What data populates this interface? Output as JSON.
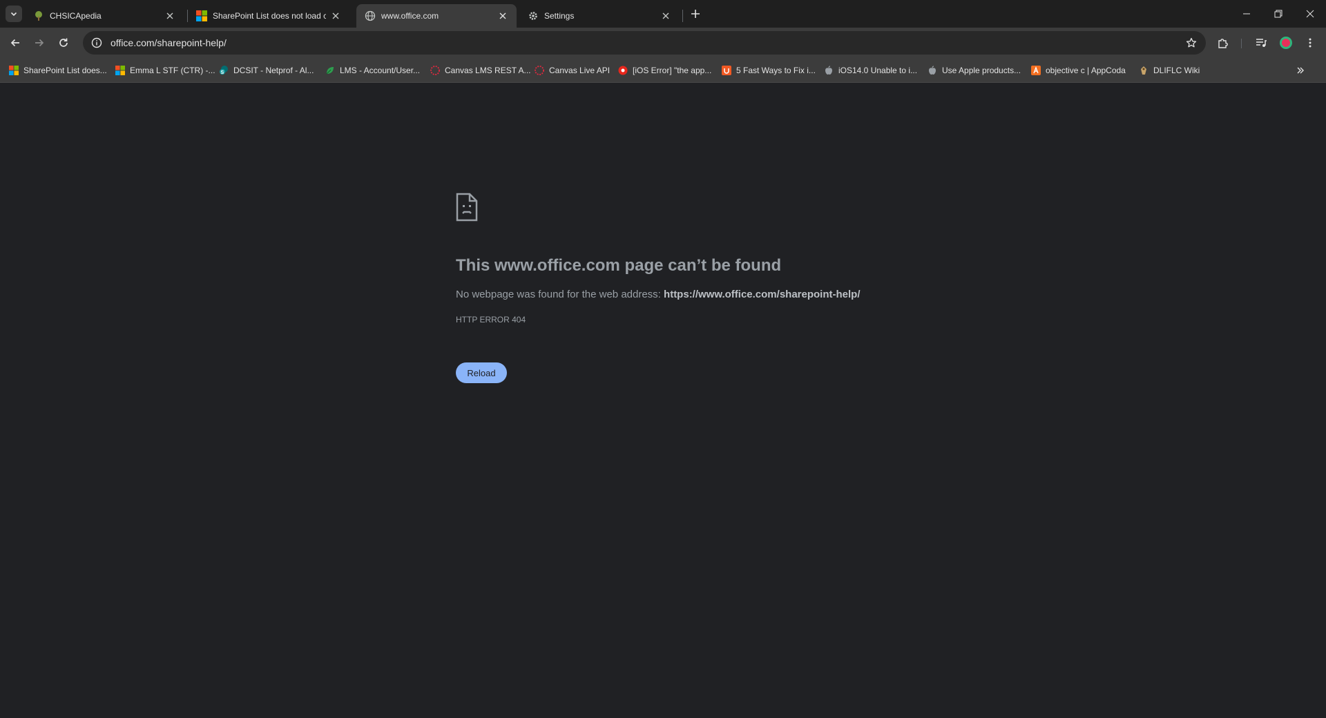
{
  "colors": {
    "accent": "#8ab4f8",
    "page_bg": "#202124",
    "toolbar_bg": "#3c3c3c",
    "tab_strip_bg": "#1f1f1f"
  },
  "tabs": [
    {
      "title": "CHSICApedia",
      "icon": "tree-icon",
      "active": false
    },
    {
      "title": "SharePoint List does not load co",
      "icon": "microsoft-logo-icon",
      "active": false
    },
    {
      "title": "www.office.com",
      "icon": "globe-icon",
      "active": true
    },
    {
      "title": "Settings",
      "icon": "gear-icon",
      "active": false
    }
  ],
  "address_bar": {
    "url": "office.com/sharepoint-help/"
  },
  "bookmarks": [
    {
      "label": "SharePoint List does...",
      "icon": "microsoft-logo-icon"
    },
    {
      "label": "Emma L STF (CTR) -...",
      "icon": "microsoft-logo-icon"
    },
    {
      "label": "DCSIT - Netprof - Al...",
      "icon": "sharepoint-icon"
    },
    {
      "label": "LMS - Account/User...",
      "icon": "green-leaf-icon"
    },
    {
      "label": "Canvas LMS REST A...",
      "icon": "canvas-icon"
    },
    {
      "label": "Canvas Live API",
      "icon": "canvas-icon"
    },
    {
      "label": "[iOS Error] \"the app...",
      "icon": "red-circle-icon"
    },
    {
      "label": "5 Fast Ways to Fix i...",
      "icon": "orange-badge-icon"
    },
    {
      "label": "iOS14.0 Unable to i...",
      "icon": "apple-icon"
    },
    {
      "label": "Use Apple products...",
      "icon": "apple-icon"
    },
    {
      "label": "objective c | AppCoda",
      "icon": "appcoda-icon"
    },
    {
      "label": "DLIFLC Wiki",
      "icon": "wiki-icon"
    }
  ],
  "error_page": {
    "title": "This www.office.com page can’t be found",
    "description_prefix": "No webpage was found for the web address:",
    "description_url": "https://www.office.com/sharepoint-help/",
    "error_code": "HTTP ERROR 404",
    "reload_label": "Reload"
  }
}
